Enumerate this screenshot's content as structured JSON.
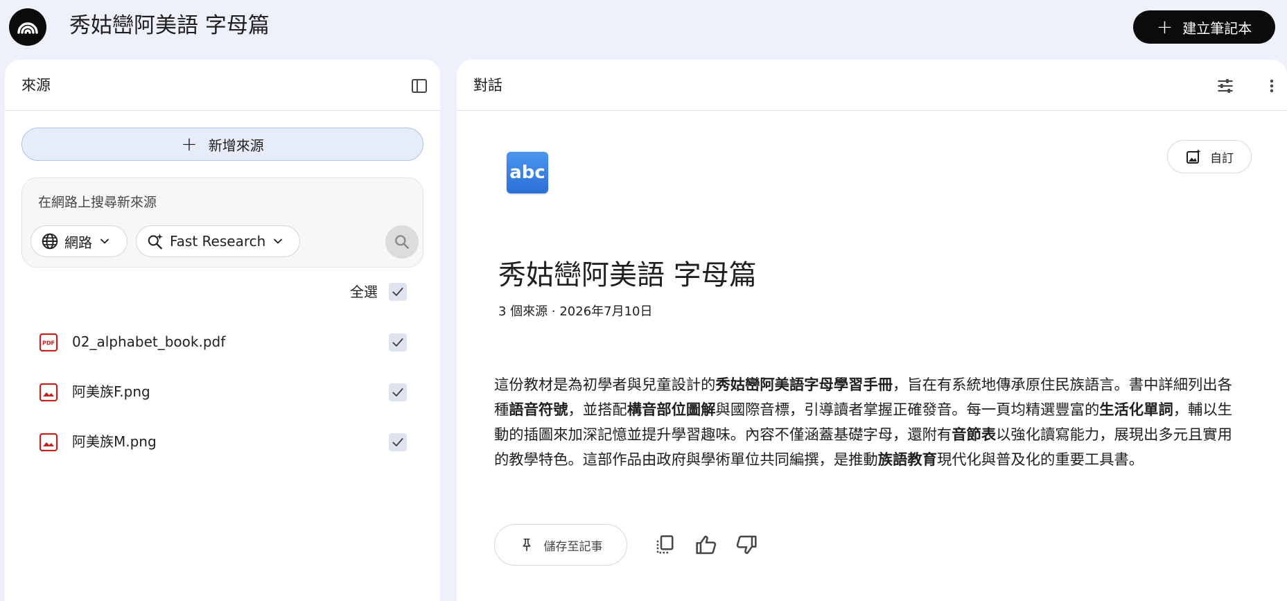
{
  "header": {
    "notebook_title": "秀姑巒阿美語 字母篇",
    "create_button_label": "建立筆記本",
    "logo_icon": "notebook-logo-icon"
  },
  "sources_panel": {
    "title": "來源",
    "add_source_label": "新增來源",
    "search": {
      "placeholder": "在網路上搜尋新來源",
      "web_chip_label": "網路",
      "research_chip_label": "Fast Research"
    },
    "select_all_label": "全選",
    "select_all_checked": true,
    "items": [
      {
        "name": "02_alphabet_book.pdf",
        "type": "pdf",
        "checked": true
      },
      {
        "name": "阿美族F.png",
        "type": "image",
        "checked": true
      },
      {
        "name": "阿美族M.png",
        "type": "image",
        "checked": true
      }
    ]
  },
  "chat_panel": {
    "title": "對話",
    "notebook_emoji_text": "abc",
    "customize_label": "自訂",
    "notebook_title": "秀姑巒阿美語 字母篇",
    "meta": "3 個來源 · 2026年7月10日",
    "summary_segments": [
      {
        "text": "這份教材是為初學者與兒童設計的",
        "bold": false
      },
      {
        "text": "秀姑巒阿美語字母學習手冊",
        "bold": true
      },
      {
        "text": "，旨在有系統地傳承原住民族語言。書中詳細列出各種",
        "bold": false
      },
      {
        "text": "語音符號",
        "bold": true
      },
      {
        "text": "，並搭配",
        "bold": false
      },
      {
        "text": "構音部位圖解",
        "bold": true
      },
      {
        "text": "與國際音標，引導讀者掌握正確發音。每一頁均精選豐富的",
        "bold": false
      },
      {
        "text": "生活化單詞",
        "bold": true
      },
      {
        "text": "，輔以生動的插圖來加深記憶並提升學習趣味。內容不僅涵蓋基礎字母，還附有",
        "bold": false
      },
      {
        "text": "音節表",
        "bold": true
      },
      {
        "text": "以強化讀寫能力，展現出多元且實用的教學特色。這部作品由政府與學術單位共同編撰，是推動",
        "bold": false
      },
      {
        "text": "族語教育",
        "bold": true
      },
      {
        "text": "現代化與普及化的重要工具書。",
        "bold": false
      }
    ],
    "save_note_label": "儲存至記事"
  },
  "colors": {
    "page_background": "#eef0fb",
    "panel_background": "#ffffff",
    "primary_dark": "#0b0b0b",
    "add_source_background": "#e6ecf8",
    "checkbox_background": "#dde3ef",
    "file_icon_red": "#c5221f"
  }
}
